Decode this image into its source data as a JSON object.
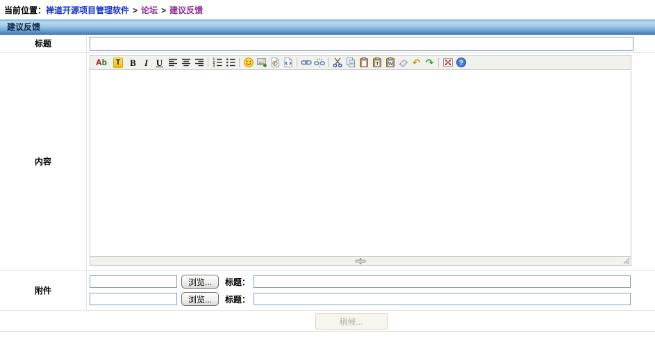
{
  "breadcrumb": {
    "label": "当前位置：",
    "separator": ">",
    "links": [
      {
        "text": "禅道开源项目管理软件"
      },
      {
        "text": "论坛"
      },
      {
        "text": "建议反馈"
      }
    ]
  },
  "header": {
    "title": "建议反馈"
  },
  "form": {
    "title_label": "标题",
    "title_value": "",
    "content_label": "内容",
    "attachment_label": "附件",
    "attachments": [
      {
        "file_value": "",
        "browse_label": "浏览...",
        "caption_label": "标题：",
        "caption_value": ""
      },
      {
        "file_value": "",
        "browse_label": "浏览...",
        "caption_label": "标题：",
        "caption_value": ""
      }
    ],
    "submit_label": "稍候..."
  },
  "editor": {
    "content": "",
    "toolbar": {
      "icons": [
        "font-color",
        "highlight",
        "bold",
        "italic",
        "underline",
        "align-left",
        "align-center",
        "align-right",
        "ordered-list",
        "unordered-list",
        "emoticon",
        "insert-image",
        "insert-media",
        "insert-code",
        "link",
        "unlink",
        "cut",
        "copy",
        "paste",
        "paste-text",
        "paste-word",
        "remove-format",
        "undo",
        "redo",
        "fullscreen",
        "help"
      ],
      "color_a": "A",
      "color_b": "b",
      "highlight_glyph": "T",
      "bold_glyph": "B",
      "italic_glyph": "I",
      "underline_glyph": "U",
      "ol_1": "1",
      "ol_2": "2",
      "ol_3": "3",
      "paste_text_glyph": "T",
      "paste_word_glyph": "W",
      "undo_glyph": "↶",
      "redo_glyph": "↷",
      "help_glyph": "?"
    }
  },
  "colors": {
    "header_gradient_top": "#b6d8f0",
    "header_gradient_bottom": "#4080b4",
    "header_text": "#0c2344",
    "link_blue": "#1330cd",
    "link_visited": "#8b2e8b",
    "input_border": "#7f9db9",
    "row_border": "#e5e5e5",
    "toolbar_bg": "#f1f1ee",
    "disabled_button_bg": "#f7f6ee",
    "disabled_button_text": "#b3b1a2"
  }
}
